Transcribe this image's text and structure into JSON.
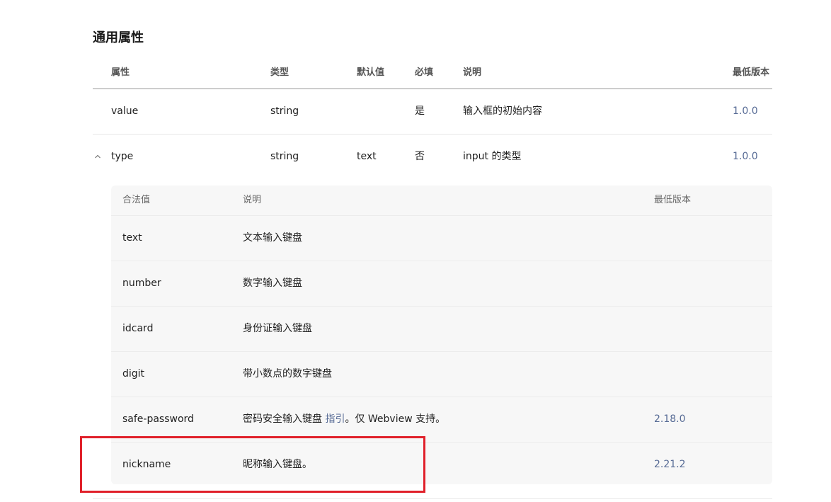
{
  "section": {
    "title": "通用属性"
  },
  "attr_table": {
    "headers": {
      "name": "属性",
      "type": "类型",
      "default": "默认值",
      "required": "必填",
      "desc": "说明",
      "version": "最低版本"
    },
    "rows": [
      {
        "name": "value",
        "type": "string",
        "default": "",
        "required": "是",
        "desc": "输入框的初始内容",
        "version": "1.0.0"
      },
      {
        "name": "type",
        "type": "string",
        "default": "text",
        "required": "否",
        "desc": "input 的类型",
        "version": "1.0.0",
        "expanded": true
      }
    ]
  },
  "type_values": {
    "headers": {
      "value": "合法值",
      "desc": "说明",
      "version": "最低版本"
    },
    "rows": [
      {
        "value": "text",
        "desc": "文本输入键盘",
        "version": ""
      },
      {
        "value": "number",
        "desc": "数字输入键盘",
        "version": ""
      },
      {
        "value": "idcard",
        "desc": "身份证输入键盘",
        "version": ""
      },
      {
        "value": "digit",
        "desc": "带小数点的数字键盘",
        "version": ""
      },
      {
        "value": "safe-password",
        "desc_before": "密码安全输入键盘 ",
        "desc_link": "指引",
        "desc_after": "。仅 Webview 支持。",
        "version": "2.18.0"
      },
      {
        "value": "nickname",
        "desc": "昵称输入键盘。",
        "version": "2.21.2"
      }
    ]
  },
  "colors": {
    "link": "#576b95",
    "highlight": "#e0202a",
    "subtable_bg": "#f7f7f7"
  },
  "icons": {
    "collapse": "chevron-up-icon"
  }
}
